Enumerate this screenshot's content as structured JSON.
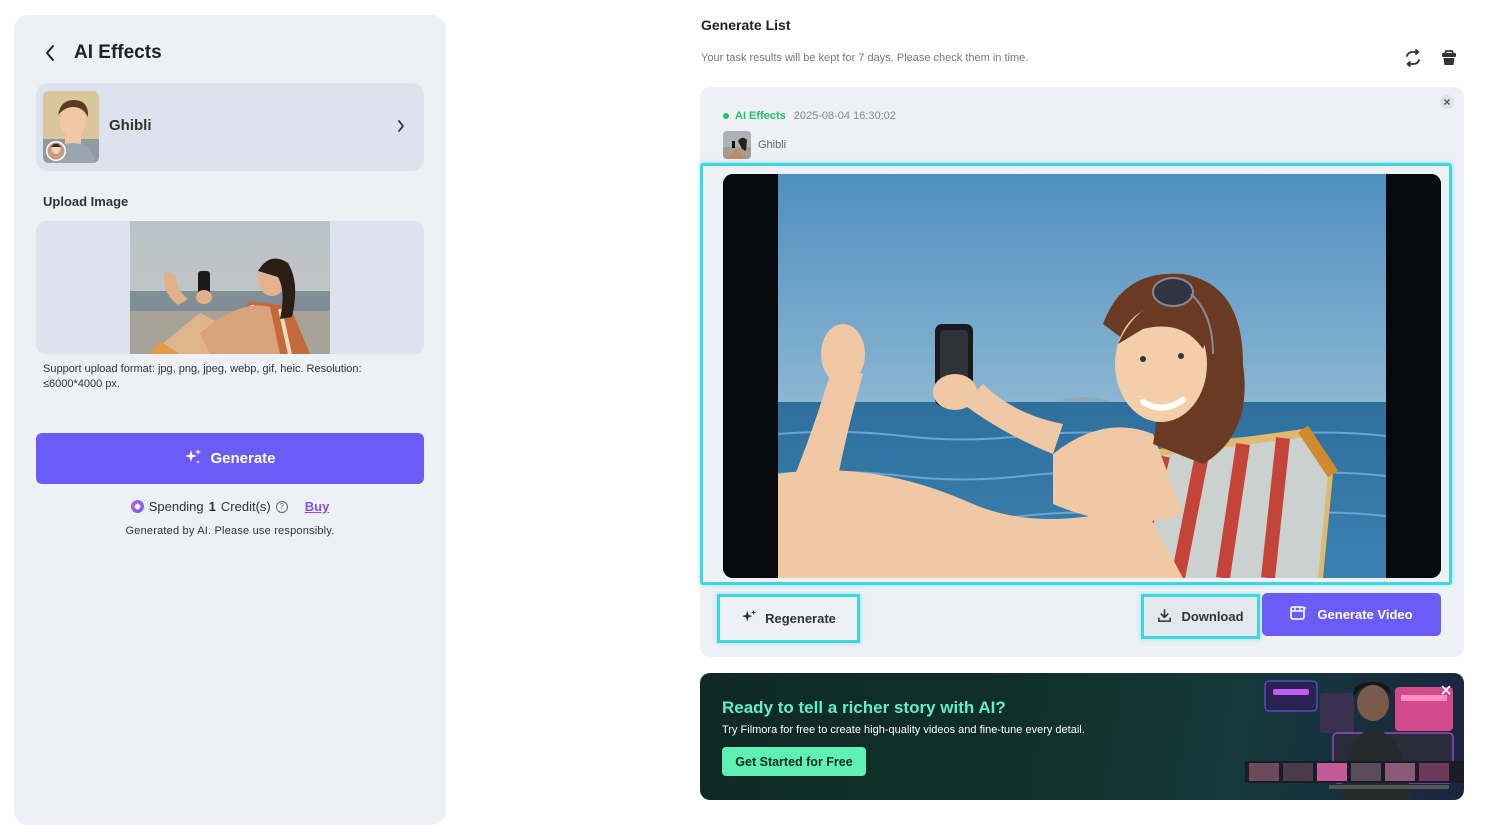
{
  "left_panel": {
    "title": "AI Effects",
    "effect": {
      "name": "Ghibli"
    },
    "upload_label": "Upload Image",
    "support_note": "Support upload format: jpg, png, jpeg, webp, gif, heic. Resolution: ≤6000*4000 px.",
    "generate_label": "Generate",
    "spending": {
      "prefix": "Spending",
      "count": "1",
      "suffix": "Credit(s)",
      "buy_label": "Buy"
    },
    "ai_note": "Generated by AI. Please use responsibly."
  },
  "generate_list": {
    "title": "Generate List",
    "subtitle": "Your task results will be kept for 7 days. Please check them in time.",
    "task": {
      "status_label": "AI Effects",
      "timestamp": "2025-08-04 16:30:02",
      "effect_name": "Ghibli",
      "regenerate_label": "Regenerate",
      "download_label": "Download",
      "generate_video_label": "Generate Video"
    }
  },
  "banner": {
    "title": "Ready to tell a richer story with AI?",
    "subtitle": "Try Filmora for free to create high-quality videos and fine-tune every detail.",
    "cta_label": "Get Started for Free"
  },
  "icons": {
    "back": "chevron-left-icon",
    "effect_chevron": "chevron-right-icon",
    "sparkle": "sparkle-icon",
    "credit": "credit-gem-icon",
    "help": "question-circle-icon",
    "refresh": "refresh-icon",
    "trash": "trash-icon",
    "close": "close-icon",
    "download": "download-icon",
    "video": "video-sparkle-icon"
  },
  "colors": {
    "accent": "#6c5cf6",
    "status_green": "#1fc16b",
    "highlight": "#3fd6e0",
    "buy_purple": "#8a4ef0",
    "banner_green": "#5ff0c4"
  }
}
